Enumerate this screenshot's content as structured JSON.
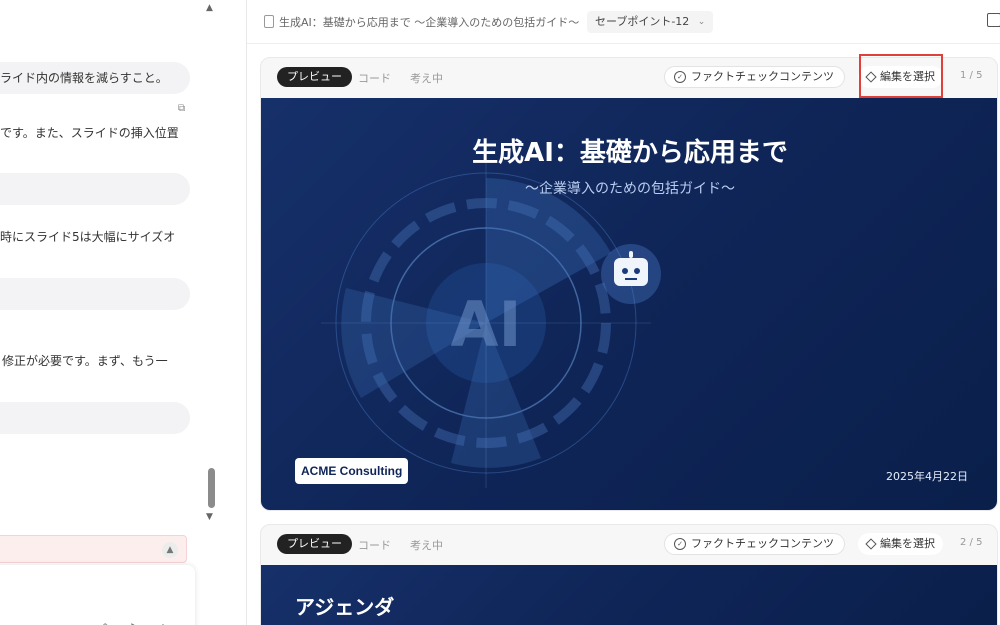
{
  "chat": {
    "lines": [
      "ライド内の情報を減らすこと。",
      "です。また、スライドの挿入位置",
      "時にスライド5は大幅にサイズオ",
      "修正が必要です。まず、もう一"
    ]
  },
  "header": {
    "title": "生成AI：基礎から応用まで ～企業導入のための包括ガイド～",
    "save_point": "セーブポイント-12"
  },
  "cards": [
    {
      "tabs": {
        "preview": "プレビュー",
        "code": "コード",
        "thinking": "考え中"
      },
      "fact_check": "ファクトチェックコンテンツ",
      "edit_select": "編集を選択",
      "page": "1 / 5",
      "slide": {
        "title": "生成AI：基礎から応用まで",
        "subtitle": "～企業導入のための包括ガイド～",
        "graphic_text": "AI",
        "company": "ACME Consulting",
        "date": "2025年4月22日"
      }
    },
    {
      "tabs": {
        "preview": "プレビュー",
        "code": "コード",
        "thinking": "考え中"
      },
      "fact_check": "ファクトチェックコンテンツ",
      "edit_select": "編集を選択",
      "page": "2 / 5",
      "slide": {
        "title": "アジェンダ"
      }
    }
  ],
  "colors": {
    "slide_bg": "#0f2557",
    "highlight": "#e0403a",
    "accent_dark": "#222222"
  },
  "icons": [
    "doc-icon",
    "external-link-icon",
    "check-circle-icon",
    "diamond-icon",
    "robot-icon",
    "edit-icon",
    "attach-icon",
    "mic-icon",
    "add-icon"
  ]
}
